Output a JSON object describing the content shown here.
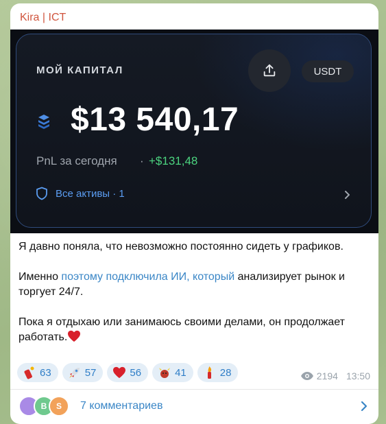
{
  "channel": {
    "name": "Kira | ICT",
    "name_color": "#d0553e"
  },
  "card": {
    "title": "МОЙ КАПИТАЛ",
    "currency_button": "USDT",
    "share_icon": "share-icon",
    "coin_icon": "stack-coin-icon",
    "amount": "$13 540,17",
    "pnl_label": "PnL за сегодня",
    "pnl_separator": "·",
    "pnl_value": "+$131,48",
    "pnl_color": "#4cd47f",
    "assets_icon": "shield-icon",
    "assets_label": "Все активы · 1",
    "border_color": "#2f4b7c"
  },
  "post": {
    "p1": "Я давно поняла, что невозможно постоянно сидеть у графиков.",
    "p2_before": "Именно ",
    "p2_link": "поэтому подключила ИИ, который",
    "p2_after": " анализирует рынок и торгует 24/7.",
    "p3": "Пока я отдыхаю или занимаюсь своими делами, он продолжает работать.",
    "p3_emoji": "heart-icon"
  },
  "reactions": [
    {
      "emoji": "firecracker-icon",
      "count": "63"
    },
    {
      "emoji": "rocket-icon",
      "count": "57"
    },
    {
      "emoji": "heart-icon",
      "count": "56"
    },
    {
      "emoji": "bull-icon",
      "count": "41"
    },
    {
      "emoji": "fire-icon",
      "count": "28"
    }
  ],
  "meta": {
    "views": "2194",
    "time": "13:50",
    "views_icon": "eye-icon"
  },
  "comments": {
    "avatars": [
      {
        "letter": "",
        "color": "#a98ae6"
      },
      {
        "letter": "B",
        "color": "#6fc98e"
      },
      {
        "letter": "S",
        "color": "#f2a25a"
      }
    ],
    "label": "7 комментариев"
  },
  "colors": {
    "accent": "#3a86c6",
    "reaction_bg": "#e4eef7"
  }
}
